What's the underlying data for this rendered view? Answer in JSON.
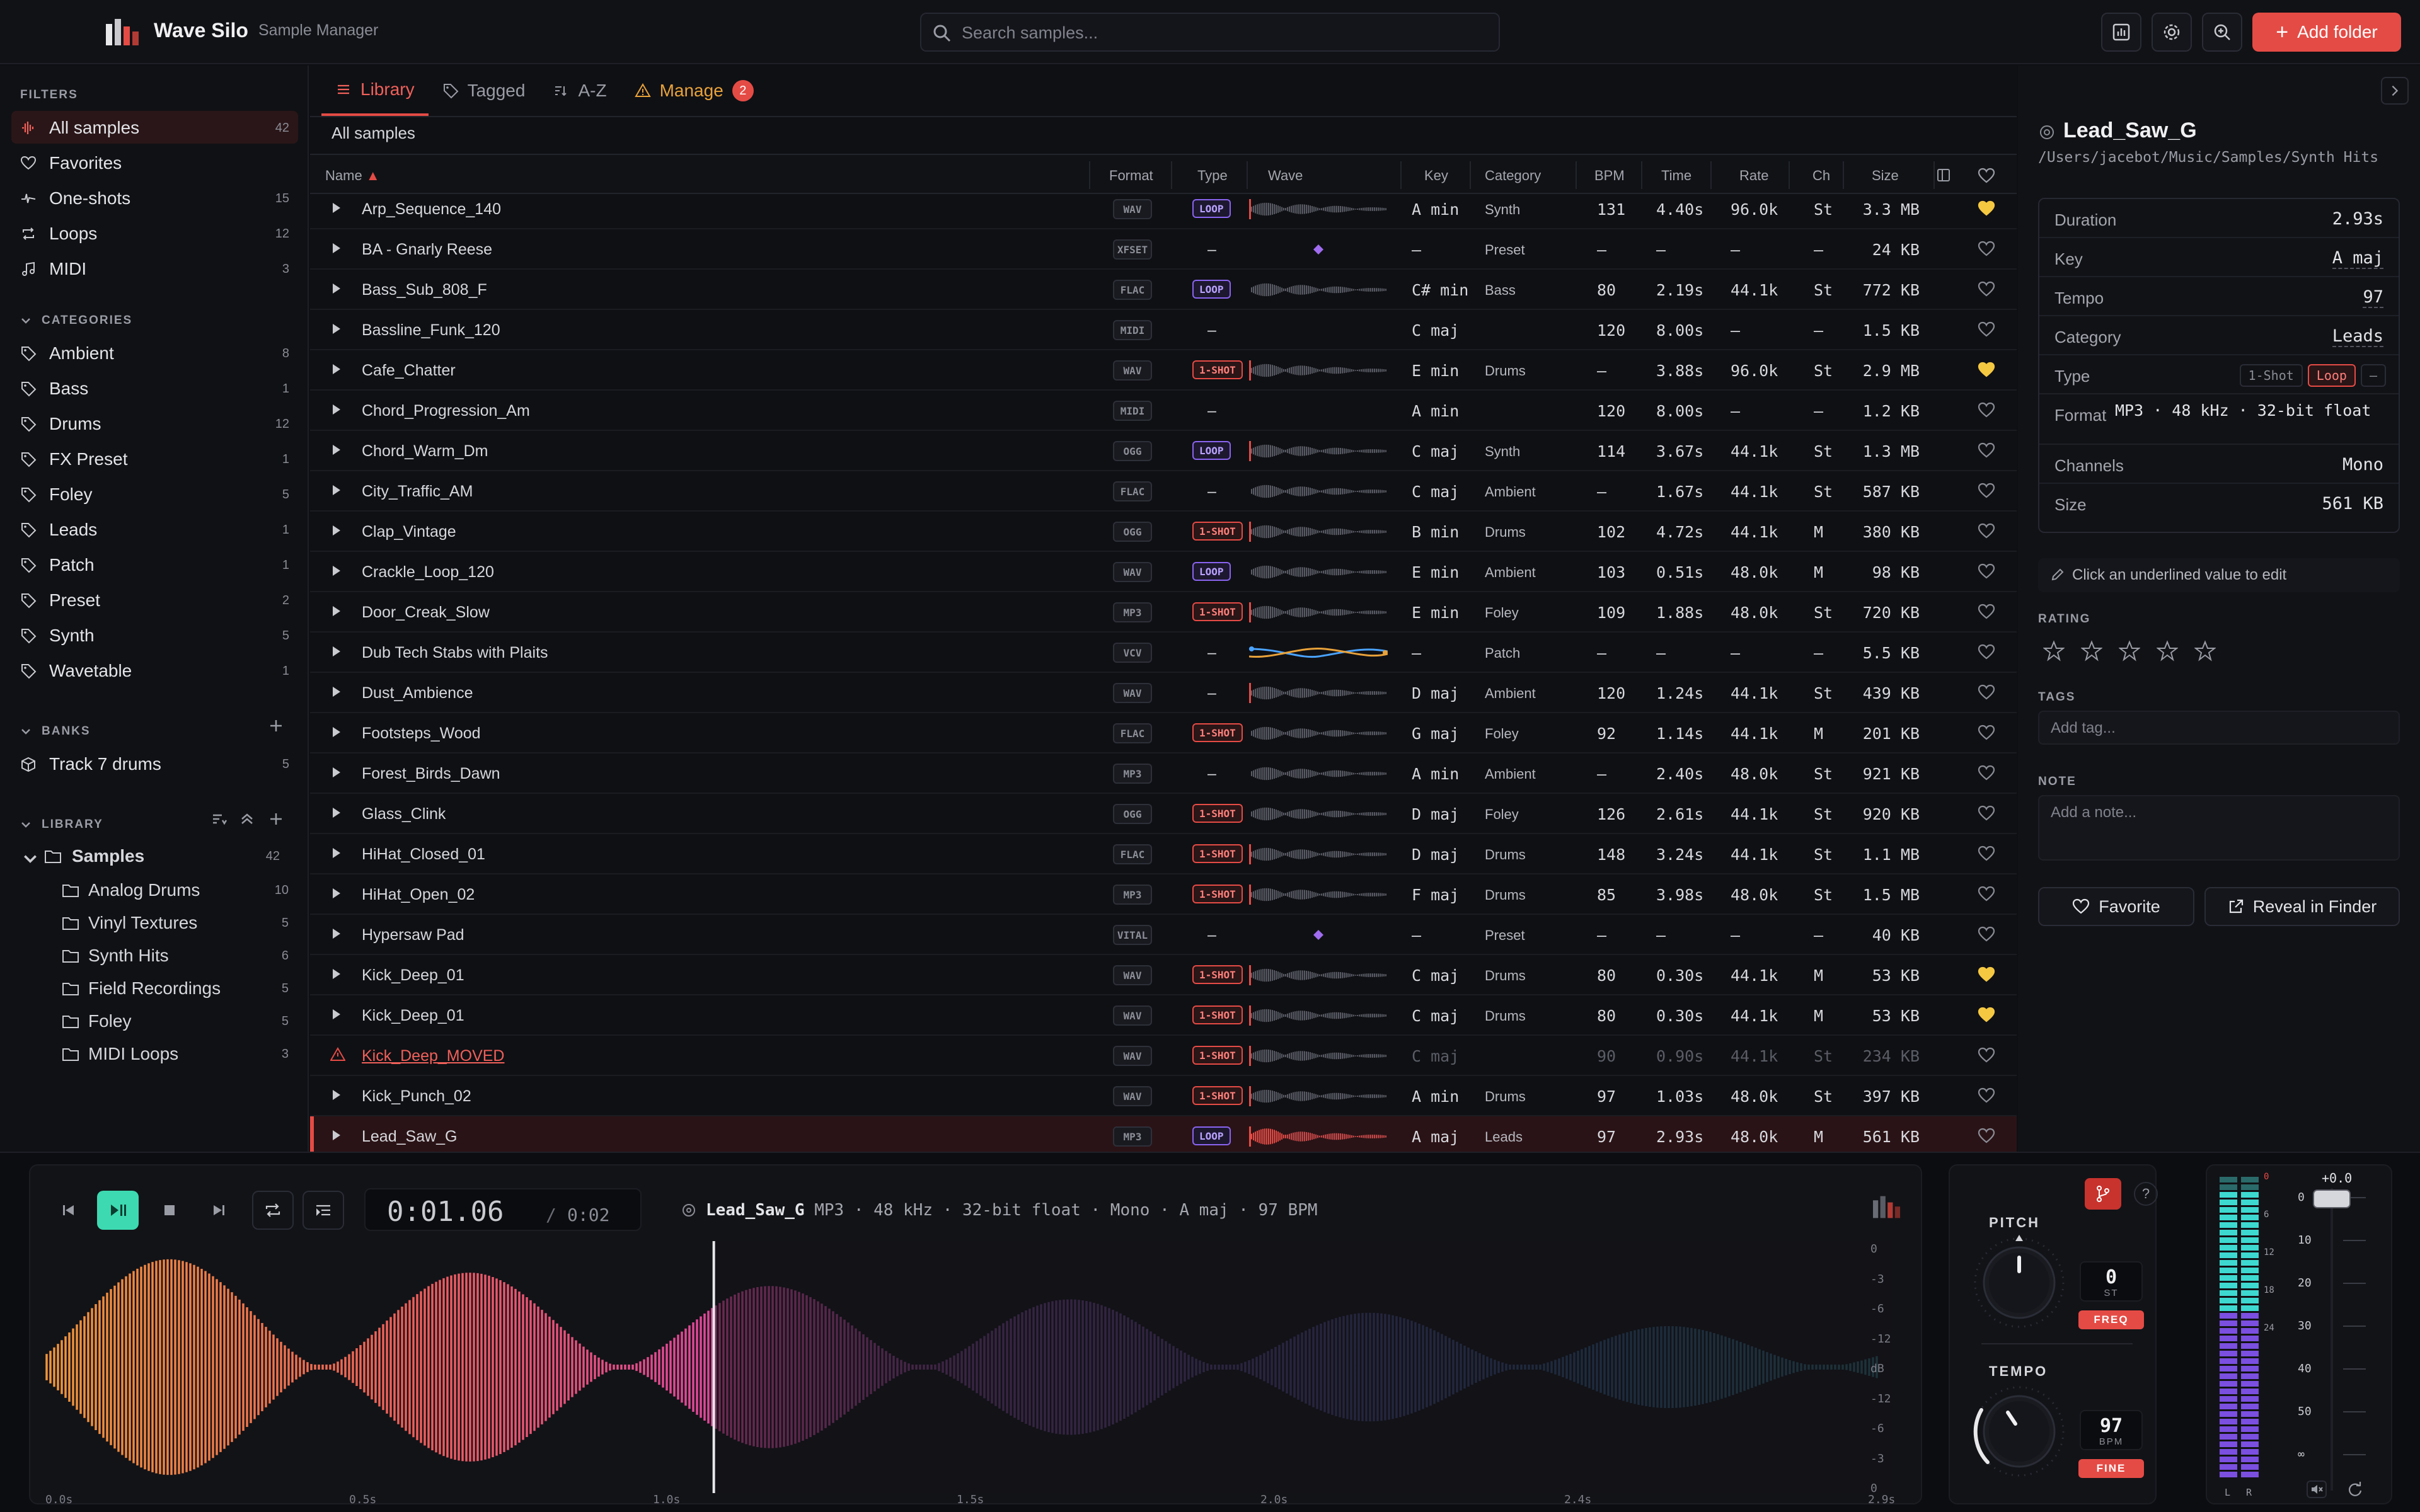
{
  "app": {
    "name": "Wave Silo",
    "subtitle": "Sample Manager"
  },
  "search": {
    "placeholder": "Search samples..."
  },
  "toolbar": {
    "add_folder": "Add folder"
  },
  "sidebar": {
    "filters_title": "FILTERS",
    "filters": [
      {
        "label": "All samples",
        "count": "42",
        "icon": "waveform-icon",
        "active": true
      },
      {
        "label": "Favorites",
        "count": "",
        "icon": "heart-icon"
      },
      {
        "label": "One-shots",
        "count": "15",
        "icon": "one-shot-icon"
      },
      {
        "label": "Loops",
        "count": "12",
        "icon": "loop-icon"
      },
      {
        "label": "MIDI",
        "count": "3",
        "icon": "music-note-icon"
      }
    ],
    "categories_title": "CATEGORIES",
    "categories": [
      {
        "label": "Ambient",
        "count": "8"
      },
      {
        "label": "Bass",
        "count": "1"
      },
      {
        "label": "Drums",
        "count": "12"
      },
      {
        "label": "FX Preset",
        "count": "1"
      },
      {
        "label": "Foley",
        "count": "5"
      },
      {
        "label": "Leads",
        "count": "1"
      },
      {
        "label": "Patch",
        "count": "1"
      },
      {
        "label": "Preset",
        "count": "2"
      },
      {
        "label": "Synth",
        "count": "5"
      },
      {
        "label": "Wavetable",
        "count": "1"
      }
    ],
    "banks_title": "BANKS",
    "banks": [
      {
        "label": "Track 7 drums",
        "count": "5"
      }
    ],
    "library_title": "LIBRARY",
    "library_root": {
      "label": "Samples",
      "count": "42"
    },
    "library_children": [
      {
        "label": "Analog Drums",
        "count": "10"
      },
      {
        "label": "Vinyl Textures",
        "count": "5"
      },
      {
        "label": "Synth Hits",
        "count": "6"
      },
      {
        "label": "Field Recordings",
        "count": "5"
      },
      {
        "label": "Foley",
        "count": "5"
      },
      {
        "label": "MIDI Loops",
        "count": "3"
      }
    ]
  },
  "tabs": [
    {
      "label": "Library",
      "active": true
    },
    {
      "label": "Tagged"
    },
    {
      "label": "A-Z"
    },
    {
      "label": "Manage",
      "badge": "2"
    }
  ],
  "breadcrumb": "All samples",
  "columns": {
    "name": "Name",
    "format": "Format",
    "type": "Type",
    "wave": "Wave",
    "key": "Key",
    "category": "Category",
    "bpm": "BPM",
    "time": "Time",
    "rate": "Rate",
    "ch": "Ch",
    "size": "Size"
  },
  "rows": [
    {
      "name": "Arp_Sequence_140",
      "format": "WAV",
      "type": "LOOP",
      "wave": "red",
      "key": "A min",
      "category": "Synth",
      "bpm": "131",
      "time": "4.40s",
      "rate": "96.0k",
      "ch": "St",
      "size": "3.3 MB",
      "fav": true
    },
    {
      "name": "BA - Gnarly Reese",
      "format": "XFSET",
      "type": "–",
      "wave": "diamond",
      "key": "–",
      "category": "Preset",
      "bpm": "–",
      "time": "–",
      "rate": "–",
      "ch": "–",
      "size": "24 KB",
      "fav": false
    },
    {
      "name": "Bass_Sub_808_F",
      "format": "FLAC",
      "type": "LOOP",
      "wave": "plain",
      "key": "C# min",
      "category": "Bass",
      "bpm": "80",
      "time": "2.19s",
      "rate": "44.1k",
      "ch": "St",
      "size": "772 KB",
      "fav": false
    },
    {
      "name": "Bassline_Funk_120",
      "format": "MIDI",
      "type": "–",
      "wave": "none",
      "key": "C maj",
      "category": "",
      "bpm": "120",
      "time": "8.00s",
      "rate": "–",
      "ch": "–",
      "size": "1.5 KB",
      "fav": false
    },
    {
      "name": "Cafe_Chatter",
      "format": "WAV",
      "type": "1-SHOT",
      "wave": "red",
      "key": "E min",
      "category": "Drums",
      "bpm": "–",
      "time": "3.88s",
      "rate": "96.0k",
      "ch": "St",
      "size": "2.9 MB",
      "fav": true
    },
    {
      "name": "Chord_Progression_Am",
      "format": "MIDI",
      "type": "–",
      "wave": "none",
      "key": "A min",
      "category": "",
      "bpm": "120",
      "time": "8.00s",
      "rate": "–",
      "ch": "–",
      "size": "1.2 KB",
      "fav": false
    },
    {
      "name": "Chord_Warm_Dm",
      "format": "OGG",
      "type": "LOOP",
      "wave": "red",
      "key": "C maj",
      "category": "Synth",
      "bpm": "114",
      "time": "3.67s",
      "rate": "44.1k",
      "ch": "St",
      "size": "1.3 MB",
      "fav": false
    },
    {
      "name": "City_Traffic_AM",
      "format": "FLAC",
      "type": "–",
      "wave": "plain",
      "key": "C maj",
      "category": "Ambient",
      "bpm": "–",
      "time": "1.67s",
      "rate": "44.1k",
      "ch": "St",
      "size": "587 KB",
      "fav": false
    },
    {
      "name": "Clap_Vintage",
      "format": "OGG",
      "type": "1-SHOT",
      "wave": "red",
      "key": "B min",
      "category": "Drums",
      "bpm": "102",
      "time": "4.72s",
      "rate": "44.1k",
      "ch": "M",
      "size": "380 KB",
      "fav": false
    },
    {
      "name": "Crackle_Loop_120",
      "format": "WAV",
      "type": "LOOP",
      "wave": "plain",
      "key": "E min",
      "category": "Ambient",
      "bpm": "103",
      "time": "0.51s",
      "rate": "48.0k",
      "ch": "M",
      "size": "98 KB",
      "fav": false
    },
    {
      "name": "Door_Creak_Slow",
      "format": "MP3",
      "type": "1-SHOT",
      "wave": "red",
      "key": "E min",
      "category": "Foley",
      "bpm": "109",
      "time": "1.88s",
      "rate": "48.0k",
      "ch": "St",
      "size": "720 KB",
      "fav": false
    },
    {
      "name": "Dub Tech Stabs with Plaits",
      "format": "VCV",
      "type": "–",
      "wave": "patch",
      "key": "–",
      "category": "Patch",
      "bpm": "–",
      "time": "–",
      "rate": "–",
      "ch": "–",
      "size": "5.5 KB",
      "fav": false
    },
    {
      "name": "Dust_Ambience",
      "format": "WAV",
      "type": "–",
      "wave": "red",
      "key": "D maj",
      "category": "Ambient",
      "bpm": "120",
      "time": "1.24s",
      "rate": "44.1k",
      "ch": "St",
      "size": "439 KB",
      "fav": false
    },
    {
      "name": "Footsteps_Wood",
      "format": "FLAC",
      "type": "1-SHOT",
      "wave": "plain",
      "key": "G maj",
      "category": "Foley",
      "bpm": "92",
      "time": "1.14s",
      "rate": "44.1k",
      "ch": "M",
      "size": "201 KB",
      "fav": false
    },
    {
      "name": "Forest_Birds_Dawn",
      "format": "MP3",
      "type": "–",
      "wave": "plain",
      "key": "A min",
      "category": "Ambient",
      "bpm": "–",
      "time": "2.40s",
      "rate": "48.0k",
      "ch": "St",
      "size": "921 KB",
      "fav": false
    },
    {
      "name": "Glass_Clink",
      "format": "OGG",
      "type": "1-SHOT",
      "wave": "plain",
      "key": "D maj",
      "category": "Foley",
      "bpm": "126",
      "time": "2.61s",
      "rate": "44.1k",
      "ch": "St",
      "size": "920 KB",
      "fav": false
    },
    {
      "name": "HiHat_Closed_01",
      "format": "FLAC",
      "type": "1-SHOT",
      "wave": "red",
      "key": "D maj",
      "category": "Drums",
      "bpm": "148",
      "time": "3.24s",
      "rate": "44.1k",
      "ch": "St",
      "size": "1.1 MB",
      "fav": false
    },
    {
      "name": "HiHat_Open_02",
      "format": "MP3",
      "type": "1-SHOT",
      "wave": "red",
      "key": "F maj",
      "category": "Drums",
      "bpm": "85",
      "time": "3.98s",
      "rate": "48.0k",
      "ch": "St",
      "size": "1.5 MB",
      "fav": false
    },
    {
      "name": "Hypersaw Pad",
      "format": "VITAL",
      "type": "–",
      "wave": "diamond",
      "key": "–",
      "category": "Preset",
      "bpm": "–",
      "time": "–",
      "rate": "–",
      "ch": "–",
      "size": "40 KB",
      "fav": false
    },
    {
      "name": "Kick_Deep_01",
      "format": "WAV",
      "type": "1-SHOT",
      "wave": "red",
      "key": "C maj",
      "category": "Drums",
      "bpm": "80",
      "time": "0.30s",
      "rate": "44.1k",
      "ch": "M",
      "size": "53 KB",
      "fav": true
    },
    {
      "name": "Kick_Deep_01",
      "format": "WAV",
      "type": "1-SHOT",
      "wave": "red",
      "key": "C maj",
      "category": "Drums",
      "bpm": "80",
      "time": "0.30s",
      "rate": "44.1k",
      "ch": "M",
      "size": "53 KB",
      "fav": true
    },
    {
      "name": "Kick_Deep_MOVED",
      "format": "WAV",
      "type": "1-SHOT",
      "wave": "red",
      "key": "C maj",
      "category": "",
      "bpm": "90",
      "time": "0.90s",
      "rate": "44.1k",
      "ch": "St",
      "size": "234 KB",
      "fav": false,
      "moved": true
    },
    {
      "name": "Kick_Punch_02",
      "format": "WAV",
      "type": "1-SHOT",
      "wave": "red",
      "key": "A min",
      "category": "Drums",
      "bpm": "97",
      "time": "1.03s",
      "rate": "48.0k",
      "ch": "St",
      "size": "397 KB",
      "fav": false
    },
    {
      "name": "Lead_Saw_G",
      "format": "MP3",
      "type": "LOOP",
      "wave": "selected",
      "key": "A maj",
      "category": "Leads",
      "bpm": "97",
      "time": "2.93s",
      "rate": "48.0k",
      "ch": "M",
      "size": "561 KB",
      "fav": false,
      "selected": true
    }
  ],
  "detail": {
    "title": "Lead_Saw_G",
    "path": "/Users/jacebot/Music/Samples/Synth Hits",
    "fields": [
      {
        "key": "Duration",
        "value": "2.93s"
      },
      {
        "key": "Key",
        "value": "A maj",
        "editable": true
      },
      {
        "key": "Tempo",
        "value": "97",
        "editable": true
      },
      {
        "key": "Category",
        "value": "Leads",
        "editable": true
      },
      {
        "key": "Type",
        "value": ""
      },
      {
        "key": "Format",
        "value": "MP3 · 48 kHz · 32-bit float"
      },
      {
        "key": "Channels",
        "value": "Mono"
      },
      {
        "key": "Size",
        "value": "561 KB"
      }
    ],
    "type_options": [
      "1-Shot",
      "Loop",
      "–"
    ],
    "type_selected": "Loop",
    "hint": "Click an underlined value to edit",
    "rating_title": "RATING",
    "rating": 0,
    "tags_title": "TAGS",
    "tag_placeholder": "Add tag...",
    "note_title": "NOTE",
    "note_placeholder": "Add a note...",
    "favorite_button": "Favorite",
    "reveal_button": "Reveal in Finder"
  },
  "player": {
    "current_time": "0:01.06",
    "separator": "/",
    "total_time": "0:02",
    "track_name": "Lead_Saw_G",
    "track_meta": "MP3 · 48 kHz · 32-bit float · Mono · A maj · 97 BPM",
    "playhead_fraction": 0.362,
    "db_labels": [
      "0",
      "-3",
      "-6",
      "-12",
      "dB",
      "-12",
      "-6",
      "-3",
      "0"
    ],
    "time_labels": [
      "0.0s",
      "0.5s",
      "1.0s",
      "1.5s",
      "2.0s",
      "2.4s",
      "2.9s"
    ]
  },
  "pitch": {
    "title": "PITCH",
    "value": "0",
    "unit": "ST",
    "button": "FREQ"
  },
  "tempo": {
    "title": "TEMPO",
    "value": "97",
    "unit": "BPM",
    "button": "FINE"
  },
  "meter": {
    "gain": "+0.0",
    "scale": [
      "0",
      "10",
      "20",
      "30",
      "40",
      "50",
      "∞"
    ],
    "db_ticks": [
      "0",
      "6",
      "12",
      "18",
      "24"
    ],
    "left_label": "L",
    "right_label": "R"
  },
  "colors": {
    "accent": "#e54b45",
    "play": "#3dd9b0",
    "loop": "#8a64f0",
    "fav": "#f5c842",
    "manage": "#e8a23a"
  }
}
